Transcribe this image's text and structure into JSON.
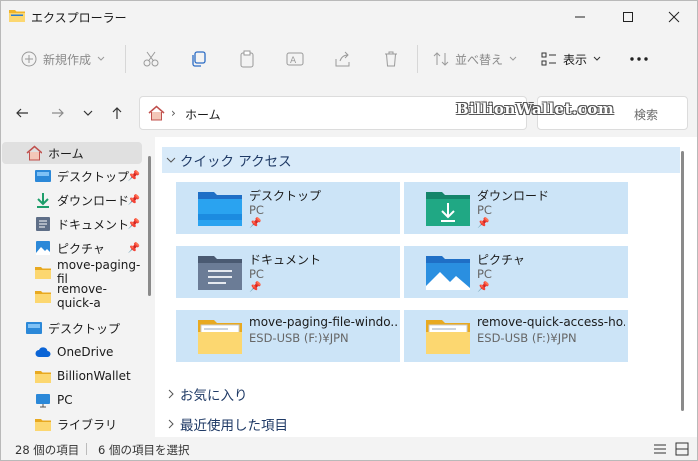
{
  "window": {
    "title": "エクスプローラー"
  },
  "toolbar": {
    "new_label": "新規作成",
    "sort_label": "並べ替え",
    "view_label": "表示"
  },
  "address": {
    "crumb": "ホーム",
    "search_placeholder": "検索"
  },
  "watermark": "BillionWallet.com",
  "sidebar": {
    "items": [
      {
        "label": "ホーム",
        "icon": "home-icon"
      },
      {
        "label": "デスクトップ",
        "icon": "desktop-icon"
      },
      {
        "label": "ダウンロード",
        "icon": "download-icon"
      },
      {
        "label": "ドキュメント",
        "icon": "document-icon"
      },
      {
        "label": "ピクチャ",
        "icon": "pictures-icon"
      },
      {
        "label": "move-paging-fil",
        "icon": "folder-icon"
      },
      {
        "label": "remove-quick-a",
        "icon": "folder-icon"
      },
      {
        "label": "デスクトップ",
        "icon": "desktop-icon"
      },
      {
        "label": "OneDrive",
        "icon": "cloud-icon"
      },
      {
        "label": "BillionWallet",
        "icon": "folder-icon"
      },
      {
        "label": "PC",
        "icon": "pc-icon"
      },
      {
        "label": "ライブラリ",
        "icon": "library-icon"
      }
    ]
  },
  "main": {
    "quick_access": "クイック アクセス",
    "favorites": "お気に入り",
    "recent": "最近使用した項目",
    "cards": [
      {
        "name": "デスクトップ",
        "sub": "PC",
        "icon": "desktop-folder-icon"
      },
      {
        "name": "ダウンロード",
        "sub": "PC",
        "icon": "download-folder-icon"
      },
      {
        "name": "ドキュメント",
        "sub": "PC",
        "icon": "document-folder-icon"
      },
      {
        "name": "ピクチャ",
        "sub": "PC",
        "icon": "pictures-folder-icon"
      },
      {
        "name": "move-paging-file-windo...",
        "sub": "ESD-USB (F:)¥JPN",
        "icon": "folder-icon"
      },
      {
        "name": "remove-quick-access-ho...",
        "sub": "ESD-USB (F:)¥JPN",
        "icon": "folder-icon"
      }
    ]
  },
  "status": {
    "count": "28 個の項目",
    "selected": "6 個の項目を選択"
  },
  "colors": {
    "accent": "#0067c0",
    "selection": "#cce4f7",
    "header_band": "#d8eaf9"
  }
}
